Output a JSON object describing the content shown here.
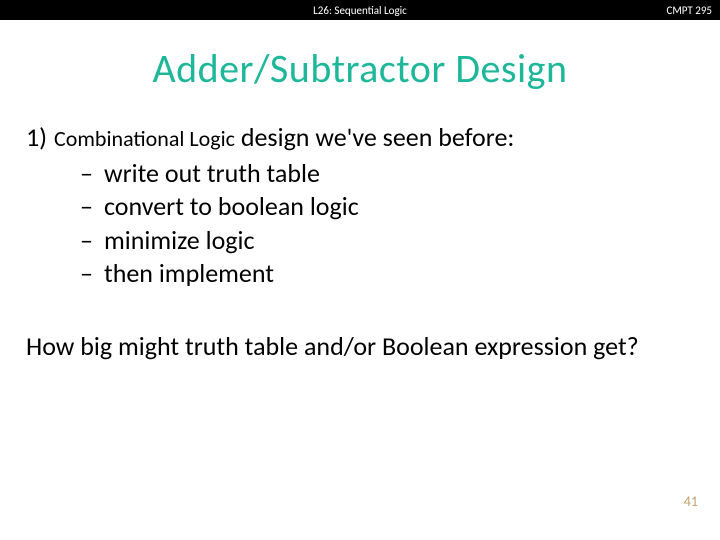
{
  "header": {
    "left": "L26: Sequential Logic",
    "right": "CMPT 295"
  },
  "title": "Adder/Subtractor Design",
  "item1": {
    "num": "1)",
    "prefix": "Combinational Logic",
    "rest": " design we've seen before:"
  },
  "sub": [
    "write out truth table",
    "convert to boolean logic",
    "minimize logic",
    "then implement"
  ],
  "dash": "–",
  "question": "How big might truth table and/or Boolean expression get?",
  "page": "41"
}
